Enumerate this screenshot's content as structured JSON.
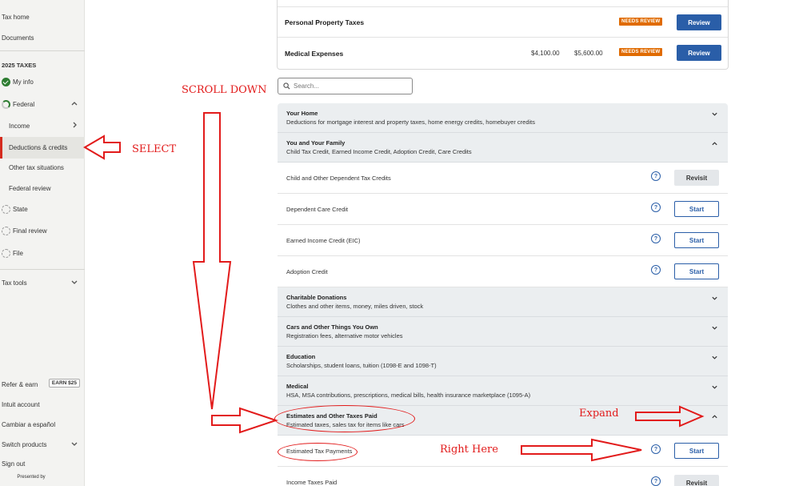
{
  "sidebar": {
    "items": {
      "tax_home": "Tax home",
      "documents": "Documents",
      "section_title": "2025 TAXES",
      "my_info": "My info",
      "federal": "Federal",
      "income": "Income",
      "deductions": "Deductions & credits",
      "other_situations": "Other tax situations",
      "federal_review": "Federal review",
      "state": "State",
      "final_review": "Final review",
      "file": "File",
      "tax_tools": "Tax tools",
      "refer": "Refer & earn",
      "earn_badge": "EARN $25",
      "intuit_account": "Intuit account",
      "espanol": "Cambiar a español",
      "switch_products": "Switch products",
      "sign_out": "Sign out",
      "presented_by": "Presented by"
    }
  },
  "top_card": {
    "rows": [
      {
        "label": "Personal Property Taxes",
        "amount1": "",
        "amount2": "",
        "badge": "NEEDS REVIEW",
        "button": "Review"
      },
      {
        "label": "Medical Expenses",
        "amount1": "$4,100.00",
        "amount2": "$5,600.00",
        "badge": "NEEDS REVIEW",
        "button": "Review"
      }
    ]
  },
  "search": {
    "placeholder": "Search..."
  },
  "categories": {
    "your_home": {
      "title": "Your Home",
      "desc": "Deductions for mortgage interest and property taxes, home energy credits, homebuyer credits"
    },
    "family": {
      "title": "You and Your Family",
      "desc": "Child Tax Credit, Earned Income Credit, Adoption Credit, Care Credits"
    },
    "charity": {
      "title": "Charitable Donations",
      "desc": "Clothes and other items, money, miles driven, stock"
    },
    "cars": {
      "title": "Cars and Other Things You Own",
      "desc": "Registration fees, alternative motor vehicles"
    },
    "education": {
      "title": "Education",
      "desc": "Scholarships, student loans, tuition (1098-E and 1098-T)"
    },
    "medical": {
      "title": "Medical",
      "desc": "HSA, MSA contributions, prescriptions, medical bills, health insurance marketplace (1095-A)"
    },
    "estimates": {
      "title": "Estimates and Other Taxes Paid",
      "desc": "Estimated taxes, sales tax for items like cars"
    }
  },
  "subitems": {
    "child_dep": {
      "label": "Child and Other Dependent Tax Credits",
      "button": "Revisit"
    },
    "dep_care": {
      "label": "Dependent Care Credit",
      "button": "Start"
    },
    "eic": {
      "label": "Earned Income Credit (EIC)",
      "button": "Start"
    },
    "adoption": {
      "label": "Adoption Credit",
      "button": "Start"
    },
    "est_payments": {
      "label": "Estimated Tax Payments",
      "button": "Start"
    },
    "income_paid": {
      "label": "Income Taxes Paid",
      "button": "Revisit"
    }
  },
  "help_glyph": "?",
  "annotations": {
    "scroll_down": "SCROLL DOWN",
    "select": "SELECT",
    "expand": "Expand",
    "right_here": "Right Here",
    "color": "#e21b1b"
  },
  "colors": {
    "accent": "#2a5ea8",
    "needs_review": "#e06b00",
    "active_marker": "#d52b1e",
    "success": "#2e7d32"
  }
}
